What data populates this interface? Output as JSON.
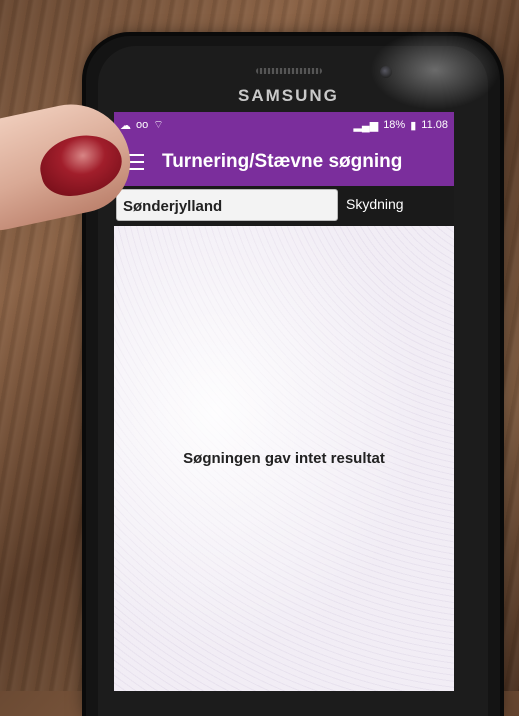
{
  "device": {
    "brand": "SAMSUNG"
  },
  "status_bar": {
    "battery": "18%",
    "time": "11.08"
  },
  "app_bar": {
    "title": "Turnering/Stævne søgning"
  },
  "filters": {
    "region": "Sønderjylland",
    "discipline": "Skydning"
  },
  "content": {
    "empty_message": "Søgningen gav intet resultat"
  },
  "colors": {
    "accent": "#7b2e9c",
    "filter_bar": "#1a1a1a"
  },
  "icons": [
    "voicemail-icon",
    "wifi-icon",
    "signal-icon",
    "battery-icon",
    "menu-icon"
  ]
}
